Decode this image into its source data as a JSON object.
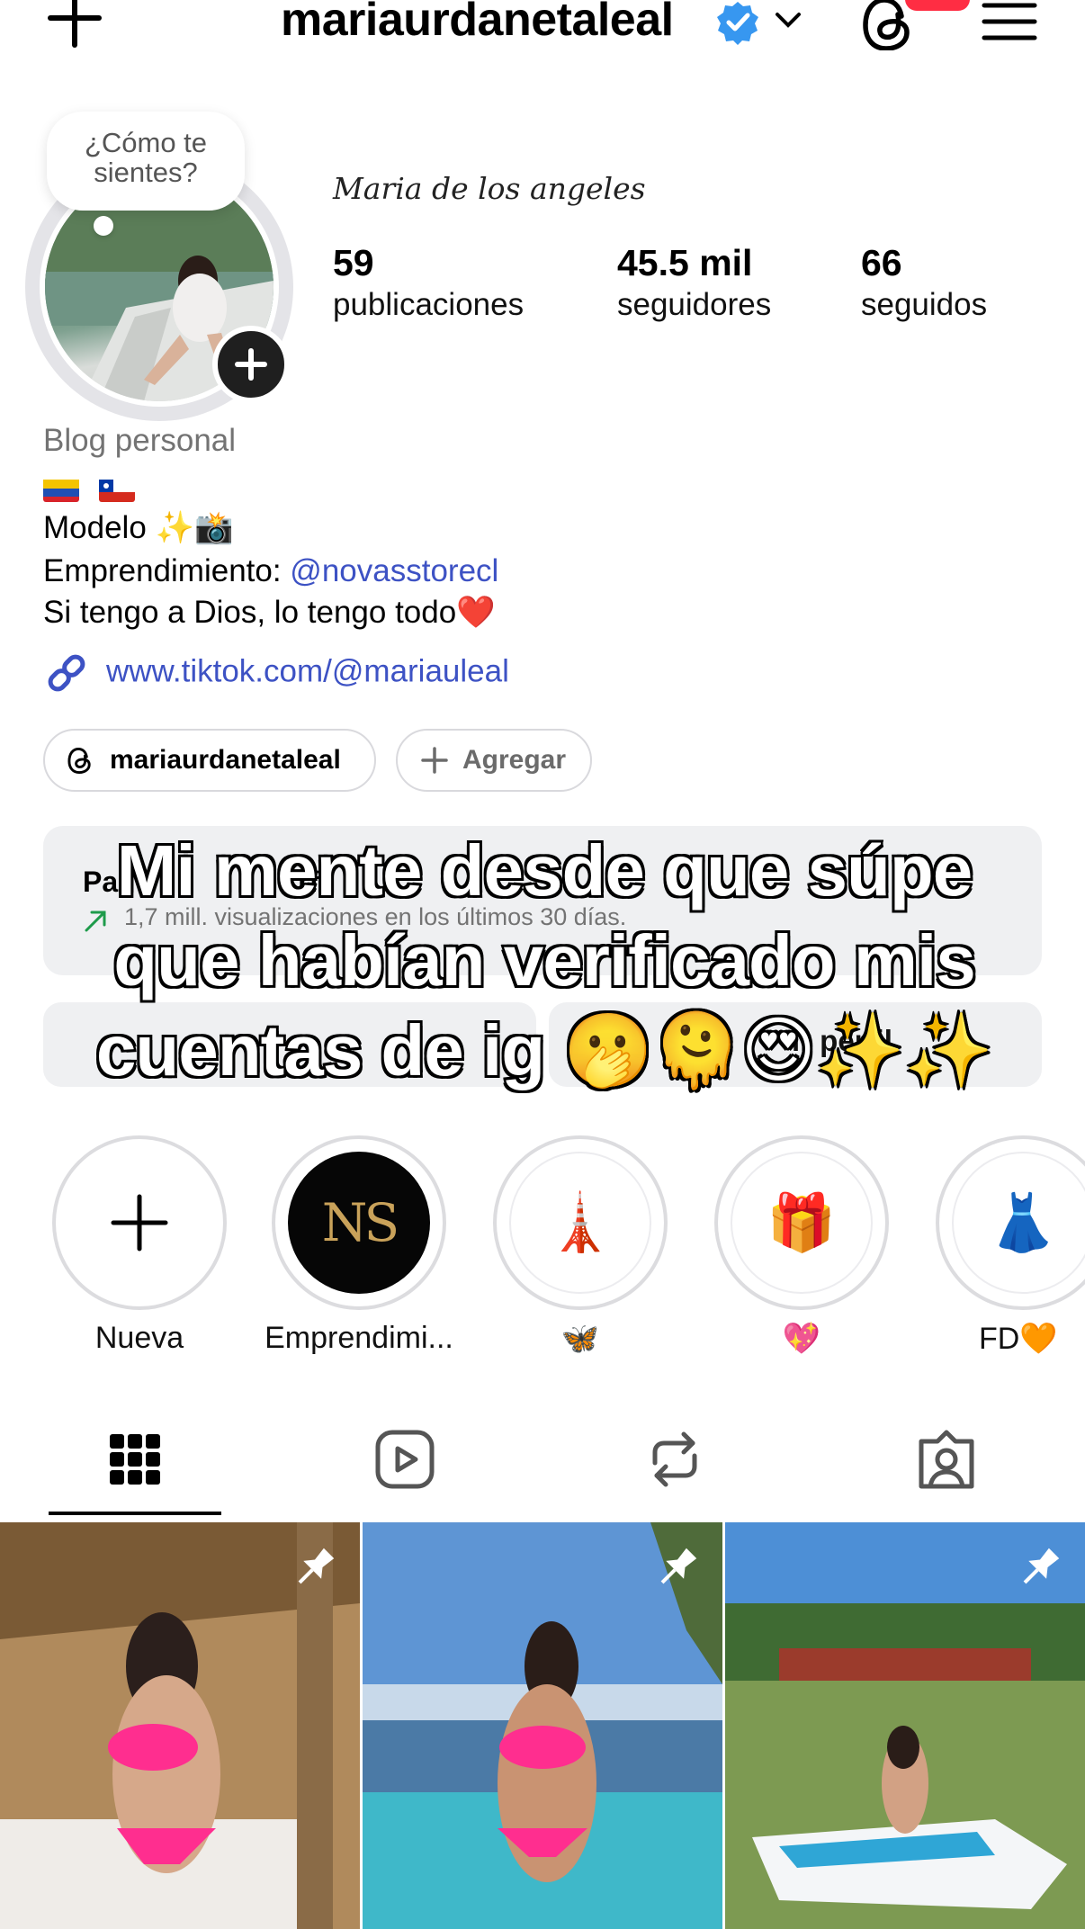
{
  "header": {
    "username": "mariaurdanetaleal",
    "verified": true
  },
  "profile": {
    "note": "¿Cómo te sientes?",
    "display_name": "Maria de los angeles",
    "stats": [
      {
        "value": "59",
        "label": "publicaciones"
      },
      {
        "value": "45.5 mil",
        "label": "seguidores"
      },
      {
        "value": "66",
        "label": "seguidos"
      }
    ]
  },
  "bio": {
    "category": "Blog personal",
    "flags": [
      "venezuela-flag",
      "chile-flag"
    ],
    "line_model": "Modelo ✨📸",
    "line_business_prefix": "Emprendimiento: ",
    "line_business_mention": "@novasstorecl",
    "line_faith": "Si tengo a Dios, lo tengo todo❤️",
    "link": "www.tiktok.com/@mariauleal"
  },
  "chips": {
    "threads_label": "mariaurdanetaleal",
    "add_label": "Agregar"
  },
  "dashboard": {
    "title": "Pa",
    "title_fragment": "rf",
    "subtitle": "1,7 mill. visualizaciones en los últimos 30 días."
  },
  "buttons": {
    "share_fragment": "ir perfil"
  },
  "caption": "Mi mente desde que súpe que habían verificado mis cuentas de ig 🫢🫠😍✨✨",
  "highlights": [
    {
      "label": "Nueva",
      "icon": "plus-icon"
    },
    {
      "label": "Emprendimi...",
      "icon": "ns-store-logo",
      "logo_text": "NS"
    },
    {
      "label": "🦋",
      "icon": "eiffel-tower-icon",
      "emoji": "🗼"
    },
    {
      "label": "💖",
      "icon": "gift-icon",
      "emoji": "🎁"
    },
    {
      "label": "FD🧡",
      "icon": "dress-icon",
      "emoji": "👗"
    }
  ],
  "tabs": [
    "grid-icon",
    "reels-icon",
    "reposts-icon",
    "tagged-icon"
  ],
  "colors": {
    "accent_link": "#3d52c4",
    "verified_blue": "#3797f0",
    "notification_red": "#ff2d43",
    "muted_text": "#737373"
  }
}
